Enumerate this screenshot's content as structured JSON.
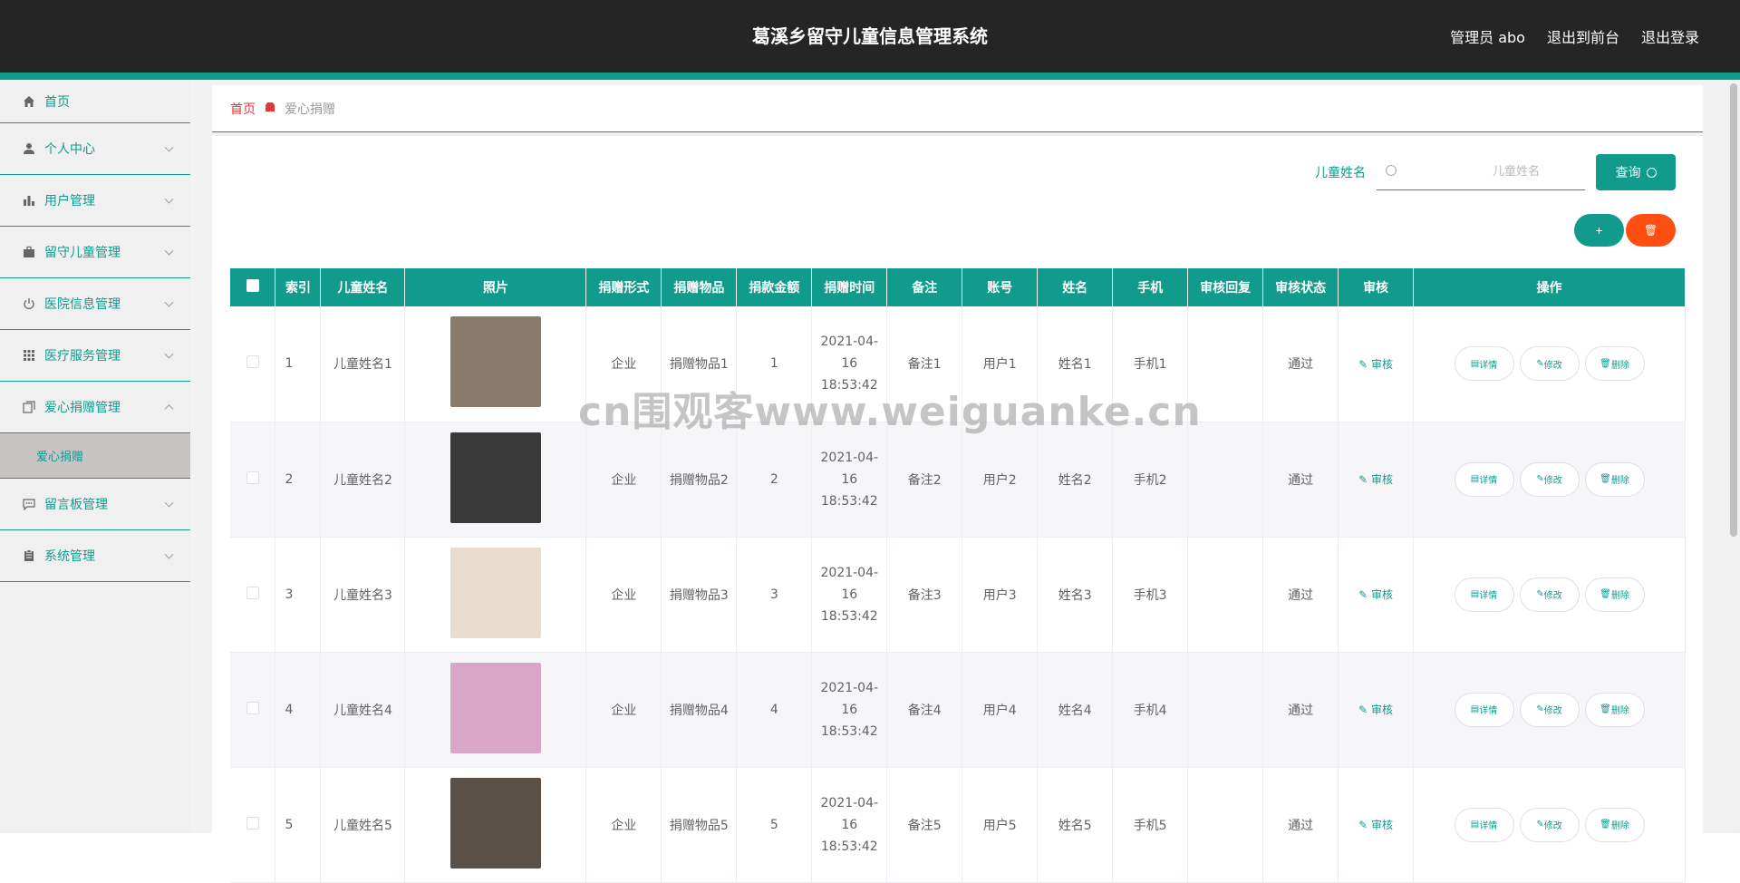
{
  "header": {
    "title": "葛溪乡留守儿童信息管理系统",
    "admin": "管理员 abo",
    "to_front": "退出到前台",
    "logout": "退出登录"
  },
  "sidebar": {
    "items": [
      {
        "label": "首页",
        "icon": "home-icon"
      },
      {
        "label": "个人中心",
        "icon": "user-icon"
      },
      {
        "label": "用户管理",
        "icon": "bar-chart-icon"
      },
      {
        "label": "留守儿童管理",
        "icon": "briefcase-icon"
      },
      {
        "label": "医院信息管理",
        "icon": "power-icon"
      },
      {
        "label": "医疗服务管理",
        "icon": "grid-icon"
      },
      {
        "label": "爱心捐赠管理",
        "icon": "copy-icon"
      },
      {
        "label": "留言板管理",
        "icon": "chat-icon"
      },
      {
        "label": "系统管理",
        "icon": "clipboard-icon"
      }
    ],
    "active_sub": "爱心捐赠"
  },
  "breadcrumb": {
    "home": "首页",
    "current": "爱心捐赠"
  },
  "search": {
    "label": "儿童姓名",
    "placeholder": "儿童姓名",
    "button": "查询"
  },
  "actions": {
    "add": "+",
    "delete": "🗑"
  },
  "table": {
    "headers": [
      "索引",
      "儿童姓名",
      "照片",
      "捐赠形式",
      "捐赠物品",
      "捐款金额",
      "捐赠时间",
      "备注",
      "账号",
      "姓名",
      "手机",
      "审核回复",
      "审核状态",
      "审核",
      "操作"
    ],
    "rows": [
      {
        "index": "1",
        "child": "儿童姓名1",
        "form": "企业",
        "item": "捐赠物品1",
        "amount": "1",
        "time": "2021-04-16 18:53:42",
        "note": "备注1",
        "account": "用户1",
        "name": "姓名1",
        "phone": "手机1",
        "reply": "",
        "status": "通过",
        "photo_color": "#8a7a6a"
      },
      {
        "index": "2",
        "child": "儿童姓名2",
        "form": "企业",
        "item": "捐赠物品2",
        "amount": "2",
        "time": "2021-04-16 18:53:42",
        "note": "备注2",
        "account": "用户2",
        "name": "姓名2",
        "phone": "手机2",
        "reply": "",
        "status": "通过",
        "photo_color": "#3a3a3a"
      },
      {
        "index": "3",
        "child": "儿童姓名3",
        "form": "企业",
        "item": "捐赠物品3",
        "amount": "3",
        "time": "2021-04-16 18:53:42",
        "note": "备注3",
        "account": "用户3",
        "name": "姓名3",
        "phone": "手机3",
        "reply": "",
        "status": "通过",
        "photo_color": "#e8dccf"
      },
      {
        "index": "4",
        "child": "儿童姓名4",
        "form": "企业",
        "item": "捐赠物品4",
        "amount": "4",
        "time": "2021-04-16 18:53:42",
        "note": "备注4",
        "account": "用户4",
        "name": "姓名4",
        "phone": "手机4",
        "reply": "",
        "status": "通过",
        "photo_color": "#d9a6c8"
      },
      {
        "index": "5",
        "child": "儿童姓名5",
        "form": "企业",
        "item": "捐赠物品5",
        "amount": "5",
        "time": "2021-04-16 18:53:42",
        "note": "备注5",
        "account": "用户5",
        "name": "姓名5",
        "phone": "手机5",
        "reply": "",
        "status": "通过",
        "photo_color": "#5a5048"
      }
    ],
    "audit_label": "审核",
    "op_detail": "详情",
    "op_edit": "修改",
    "op_delete": "删除"
  },
  "watermark": "cn围观客www.weiguanke.cn",
  "colors": {
    "accent": "#109b8d",
    "danger": "#ff4e12",
    "header_bg": "#252525"
  }
}
